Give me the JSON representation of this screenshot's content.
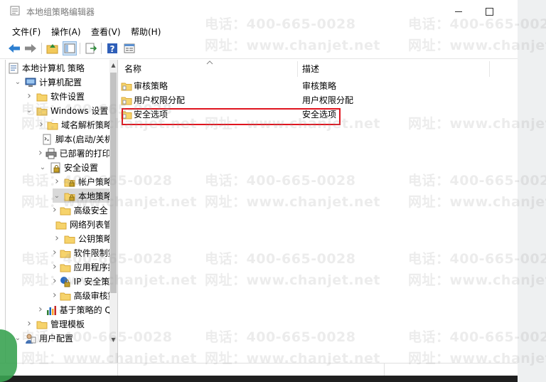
{
  "window": {
    "title": "本地组策略编辑器"
  },
  "menu": [
    "文件(F)",
    "操作(A)",
    "查看(V)",
    "帮助(H)"
  ],
  "toolbar_icons": [
    "back-arrow-icon",
    "forward-arrow-icon",
    "up-folder-icon",
    "show-hide-tree-icon",
    "export-list-icon",
    "help-icon",
    "properties-icon"
  ],
  "tree": [
    {
      "label": "本地计算机 策略",
      "icon": "policy-icon",
      "level": 0,
      "expander": ""
    },
    {
      "label": "计算机配置",
      "icon": "computer-icon",
      "level": 1,
      "expander": "expanded"
    },
    {
      "label": "软件设置",
      "icon": "folder-icon",
      "level": 2,
      "expander": "collapsed"
    },
    {
      "label": "Windows 设置",
      "icon": "folder-icon",
      "level": 2,
      "expander": "expanded"
    },
    {
      "label": "域名解析策略",
      "icon": "folder-icon",
      "level": 3,
      "expander": "collapsed"
    },
    {
      "label": "脚本(启动/关机)",
      "icon": "script-icon",
      "level": 3,
      "expander": ""
    },
    {
      "label": "已部署的打印机",
      "icon": "printer-icon",
      "level": 3,
      "expander": "collapsed"
    },
    {
      "label": "安全设置",
      "icon": "security-icon",
      "level": 3,
      "expander": "expanded"
    },
    {
      "label": "帐户策略",
      "icon": "folder-lock-icon",
      "level": 4,
      "expander": "collapsed"
    },
    {
      "label": "本地策略",
      "icon": "folder-lock-icon",
      "level": 4,
      "expander": "expanded",
      "selected": true
    },
    {
      "label": "高级安全 Windows 防火墙",
      "icon": "folder-icon",
      "level": 4,
      "expander": "collapsed"
    },
    {
      "label": "网络列表管理器策略",
      "icon": "folder-icon",
      "level": 4,
      "expander": ""
    },
    {
      "label": "公钥策略",
      "icon": "folder-icon",
      "level": 4,
      "expander": "collapsed"
    },
    {
      "label": "软件限制策略",
      "icon": "folder-icon",
      "level": 4,
      "expander": "collapsed"
    },
    {
      "label": "应用程序控制策略",
      "icon": "folder-icon",
      "level": 4,
      "expander": "collapsed"
    },
    {
      "label": "IP 安全策略",
      "icon": "ip-security-icon",
      "level": 4,
      "expander": "collapsed"
    },
    {
      "label": "高级审核策略配置",
      "icon": "folder-icon",
      "level": 4,
      "expander": "collapsed"
    },
    {
      "label": "基于策略的 QoS",
      "icon": "chart-icon",
      "level": 3,
      "expander": "collapsed"
    },
    {
      "label": "管理模板",
      "icon": "folder-icon",
      "level": 2,
      "expander": "collapsed"
    },
    {
      "label": "用户配置",
      "icon": "user-icon",
      "level": 1,
      "expander": "expanded"
    }
  ],
  "list": {
    "columns": [
      "名称",
      "描述"
    ],
    "rows": [
      {
        "name": "审核策略",
        "desc": "审核策略"
      },
      {
        "name": "用户权限分配",
        "desc": "用户权限分配"
      },
      {
        "name": "安全选项",
        "desc": "安全选项",
        "highlighted": true
      }
    ]
  },
  "watermark": {
    "phone": "电话：400-665-0028",
    "site": "网址：www.chanjet.net"
  },
  "colors": {
    "highlight_border": "#e0141e",
    "folder_fill": "#f6d36b",
    "selection": "#d9d9d9"
  }
}
